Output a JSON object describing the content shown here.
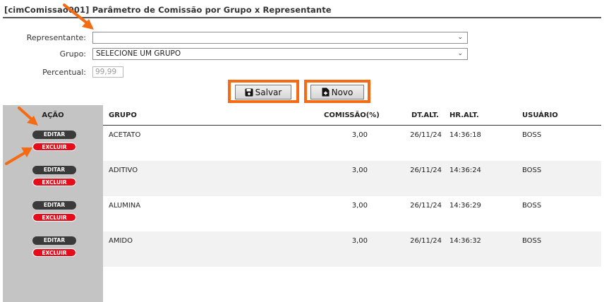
{
  "page": {
    "title": "[cimComissao001] Parâmetro de Comissão por Grupo x Representante"
  },
  "form": {
    "representante_label": "Representante:",
    "representante_value": "",
    "grupo_label": "Grupo:",
    "grupo_value": "SELECIONE UM GRUPO",
    "percentual_label": "Percentual:",
    "percentual_placeholder": "99,99"
  },
  "buttons": {
    "save_label": "Salvar",
    "new_label": "Novo"
  },
  "grid": {
    "headers": {
      "acao": "AÇÃO",
      "grupo": "GRUPO",
      "comissao": "COMISSÃO(%)",
      "dtalt": "DT.ALT.",
      "hralt": "HR.ALT.",
      "usuario": "USUÁRIO"
    },
    "edit_label": "EDITAR",
    "delete_label": "EXCLUIR",
    "rows": [
      {
        "grupo": "ACETATO",
        "comissao": "3,00",
        "dtalt": "26/11/24",
        "hralt": "14:36:18",
        "usuario": "BOSS"
      },
      {
        "grupo": "ADITIVO",
        "comissao": "3,00",
        "dtalt": "26/11/24",
        "hralt": "14:36:24",
        "usuario": "BOSS"
      },
      {
        "grupo": "ALUMINA",
        "comissao": "3,00",
        "dtalt": "26/11/24",
        "hralt": "14:36:29",
        "usuario": "BOSS"
      },
      {
        "grupo": "AMIDO",
        "comissao": "3,00",
        "dtalt": "26/11/24",
        "hralt": "14:36:32",
        "usuario": "BOSS"
      },
      {
        "grupo": "",
        "comissao": "",
        "dtalt": "",
        "hralt": "",
        "usuario": ""
      }
    ]
  },
  "colors": {
    "highlight": "#f46b14",
    "delete_pill": "#e60d1a",
    "edit_pill": "#3a3a3a",
    "action_column": "#c4c4c4"
  }
}
